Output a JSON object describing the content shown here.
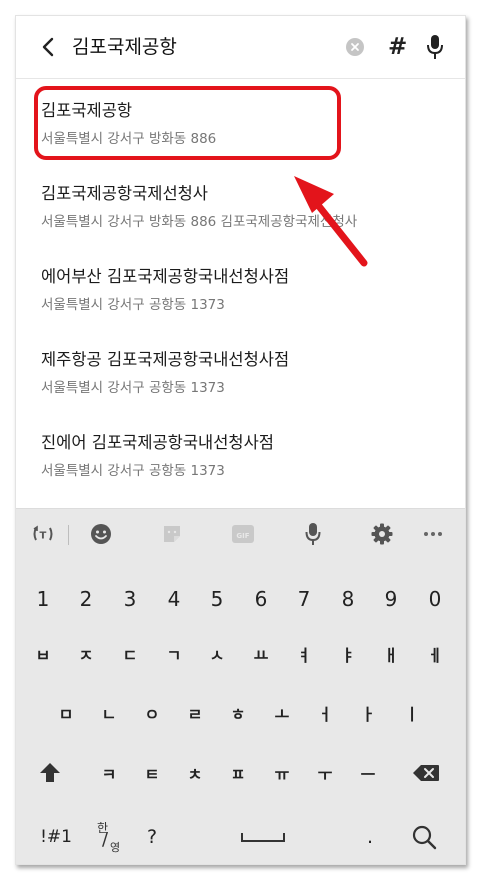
{
  "search": {
    "query": "김포국제공항",
    "hash_label": "#"
  },
  "results": [
    {
      "title": "김포국제공항",
      "address": "서울특별시 강서구 방화동  886"
    },
    {
      "title": "김포국제공항국제선청사",
      "address": "서울특별시 강서구 방화동 886 김포국제공항국제선청사"
    },
    {
      "title": "에어부산 김포국제공항국내선청사점",
      "address": "서울특별시 강서구 공항동 1373"
    },
    {
      "title": "제주항공 김포국제공항국내선청사점",
      "address": "서울특별시 강서구 공항동 1373"
    },
    {
      "title": "진에어 김포국제공항국내선청사점",
      "address": "서울특별시 강서구 공항동 1373"
    }
  ],
  "annotation": {
    "color": "#e3141b"
  },
  "keyboard": {
    "toolbar": [
      "translate-icon",
      "emoji-icon",
      "sticker-icon",
      "gif-icon",
      "microphone-icon",
      "gear-icon",
      "more-icon"
    ],
    "gif_label": "GIF",
    "numbers": [
      "1",
      "2",
      "3",
      "4",
      "5",
      "6",
      "7",
      "8",
      "9",
      "0"
    ],
    "row1": [
      "ㅂ",
      "ㅈ",
      "ㄷ",
      "ㄱ",
      "ㅅ",
      "ㅛ",
      "ㅕ",
      "ㅑ",
      "ㅐ",
      "ㅔ"
    ],
    "row2": [
      "ㅁ",
      "ㄴ",
      "ㅇ",
      "ㄹ",
      "ㅎ",
      "ㅗ",
      "ㅓ",
      "ㅏ",
      "ㅣ"
    ],
    "row3": [
      "ㅋ",
      "ㅌ",
      "ㅊ",
      "ㅍ",
      "ㅠ",
      "ㅜ",
      "ㅡ"
    ],
    "symbols_label": "!#1",
    "lang_han": "한",
    "lang_slash": "/",
    "lang_eng": "영",
    "question_label": "?",
    "period_label": "."
  }
}
